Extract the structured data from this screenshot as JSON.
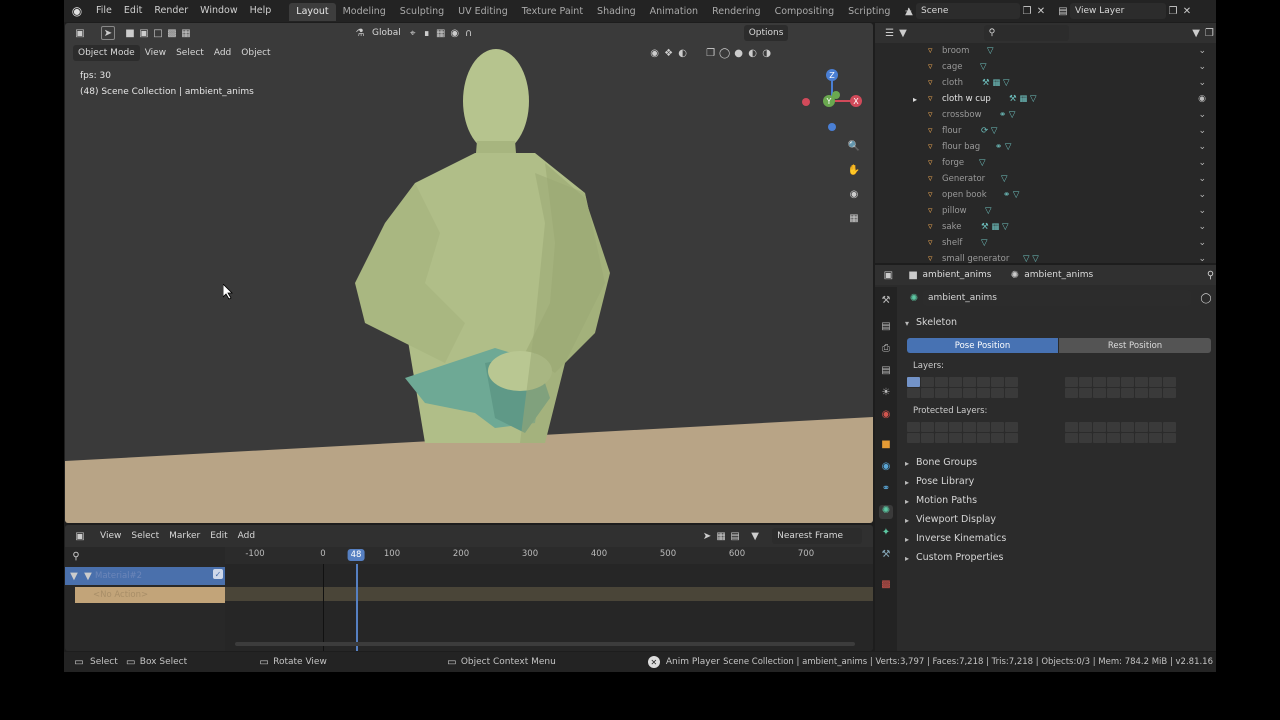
{
  "topbar": {
    "menus": [
      "File",
      "Edit",
      "Render",
      "Window",
      "Help"
    ],
    "workspaces": [
      "Layout",
      "Modeling",
      "Sculpting",
      "UV Editing",
      "Texture Paint",
      "Shading",
      "Animation",
      "Rendering",
      "Compositing",
      "Scripting"
    ],
    "active_workspace": "Layout",
    "add_tab": "+",
    "scene": "Scene",
    "view_layer": "View Layer"
  },
  "viewport": {
    "mode": "Object Mode",
    "menus": [
      "View",
      "Select",
      "Add",
      "Object"
    ],
    "orientation": "Global",
    "options_label": "Options",
    "fps_text": "fps: 30",
    "collection_text": "(48) Scene Collection | ambient_anims",
    "gizmo": {
      "x": "X",
      "y": "Y",
      "z": "Z"
    }
  },
  "timeline": {
    "menus": [
      "View",
      "Select",
      "Marker",
      "Edit",
      "Add"
    ],
    "interpolation": "Nearest Frame",
    "ticks": [
      "-100",
      "0",
      "100",
      "200",
      "300",
      "400",
      "500",
      "600",
      "700"
    ],
    "current_frame": "48",
    "channel_name": "Material#2",
    "action_label": "<No Action>"
  },
  "outliner": {
    "items": [
      {
        "name": "broom"
      },
      {
        "name": "cage"
      },
      {
        "name": "cloth"
      },
      {
        "name": "cloth w cup"
      },
      {
        "name": "crossbow"
      },
      {
        "name": "flour"
      },
      {
        "name": "flour bag"
      },
      {
        "name": "forge"
      },
      {
        "name": "Generator"
      },
      {
        "name": "open book"
      },
      {
        "name": "pillow"
      },
      {
        "name": "sake"
      },
      {
        "name": "shelf"
      },
      {
        "name": "small generator"
      }
    ]
  },
  "properties": {
    "breadcrumb_object": "ambient_anims",
    "breadcrumb_data": "ambient_anims",
    "data_name": "ambient_anims",
    "skeleton_title": "Skeleton",
    "pose_position": "Pose Position",
    "rest_position": "Rest Position",
    "layers_label": "Layers:",
    "protected_layers_label": "Protected Layers:",
    "panels": [
      "Bone Groups",
      "Pose Library",
      "Motion Paths",
      "Viewport Display",
      "Inverse Kinematics",
      "Custom Properties"
    ]
  },
  "statusbar": {
    "select": "Select",
    "box_select": "Box Select",
    "rotate_view": "Rotate View",
    "context_menu": "Object Context Menu",
    "anim_player": "Anim Player",
    "stats": "Scene Collection | ambient_anims | Verts:3,797 | Faces:7,218 | Tris:7,218 | Objects:0/3 | Mem: 784.2 MiB | v2.81.16"
  },
  "colors": {
    "accent": "#4772b3",
    "figure": "#b6c48e",
    "cloth": "#6ea995",
    "floor": "#b8a486"
  }
}
